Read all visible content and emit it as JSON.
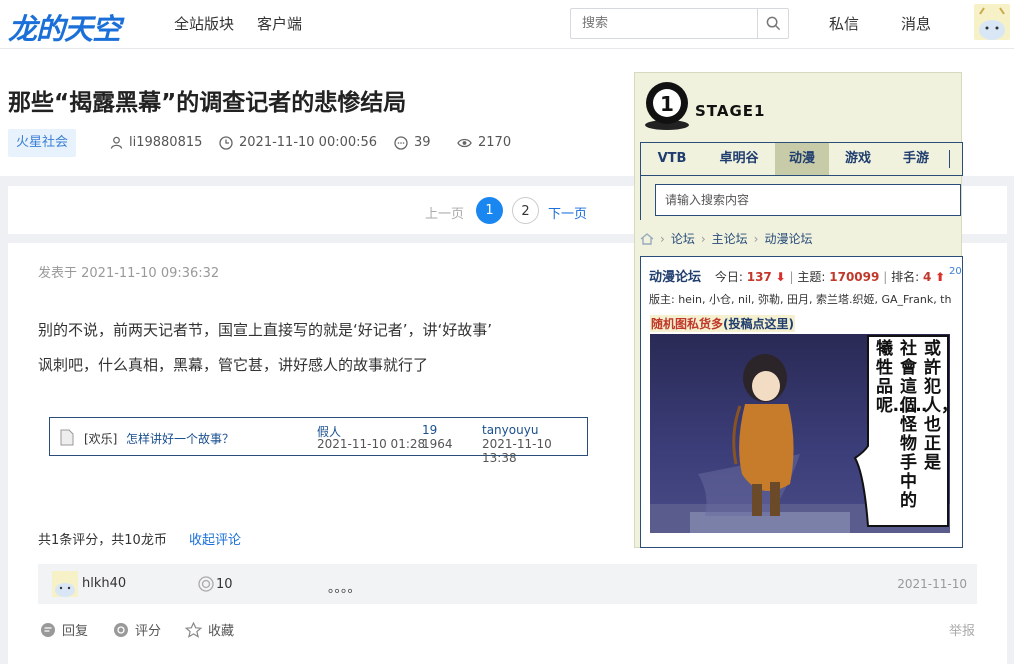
{
  "site": {
    "logo_text": "龙的天空"
  },
  "nav": {
    "forums": "全站版块",
    "client": "客户端",
    "messages": "私信",
    "notices": "消息"
  },
  "search": {
    "placeholder": "搜索"
  },
  "thread": {
    "title": "那些“揭露黑幕”的调查记者的悲惨结局",
    "tag": "火星社会",
    "author": "li19880815",
    "datetime": "2021-11-10 00:00:56",
    "replies": "39",
    "views": "2170"
  },
  "pager": {
    "prev": "上一页",
    "current": "1",
    "page2": "2",
    "next": "下一页"
  },
  "post": {
    "posted_at": "发表于 2021-11-10 09:36:32",
    "line1": "别的不说，前两天记者节，国宣上直接写的就是‘好记者’，讲‘好故事’",
    "line2": "讽刺吧，什么真相，黑幕，管它甚，讲好感人的故事就行了",
    "quote": {
      "category": "[欢乐]",
      "topic": "怎样讲好一个故事？",
      "author": "假人",
      "author_time": "2021-11-10 01:28",
      "replies": "19",
      "views": "1964",
      "last_user": "tanyouyu",
      "last_time": "2021-11-10 13:38"
    },
    "rating_summary": "共1条评分，共10龙币",
    "collapse": "收起评论",
    "rating": {
      "user": "hlkh40",
      "coins": "10",
      "comment": "。。。。",
      "date": "2021-11-10"
    },
    "actions": {
      "reply": "回复",
      "rate": "评分",
      "collect": "收藏",
      "report": "举报"
    }
  },
  "overlay": {
    "stage_text": "STAGE1",
    "stage_number": "1",
    "tabs": [
      "VTB",
      "卓明谷",
      "动漫",
      "游戏",
      "手游"
    ],
    "search_placeholder": "请输入搜索内容",
    "breadcrumb": [
      "论坛",
      "主论坛",
      "动漫论坛"
    ],
    "forum_name": "动漫论坛",
    "today_label": "今日:",
    "today_value": "137",
    "topics_label": "主题:",
    "topics_value": "170099",
    "rank_label": "排名:",
    "rank_value": "4",
    "rank_delta": "20",
    "moderators": "版主: hein, 小仓, nil, 弥勒, 田月, 索兰塔.织姬, GA_Frank, th",
    "ad_red": "随机图私货多",
    "ad_blue": "(投稿点这里)",
    "comic_text": [
      "或許犯人，也正是",
      "社會這個怪物手中的",
      "犧牲品呢……"
    ]
  }
}
